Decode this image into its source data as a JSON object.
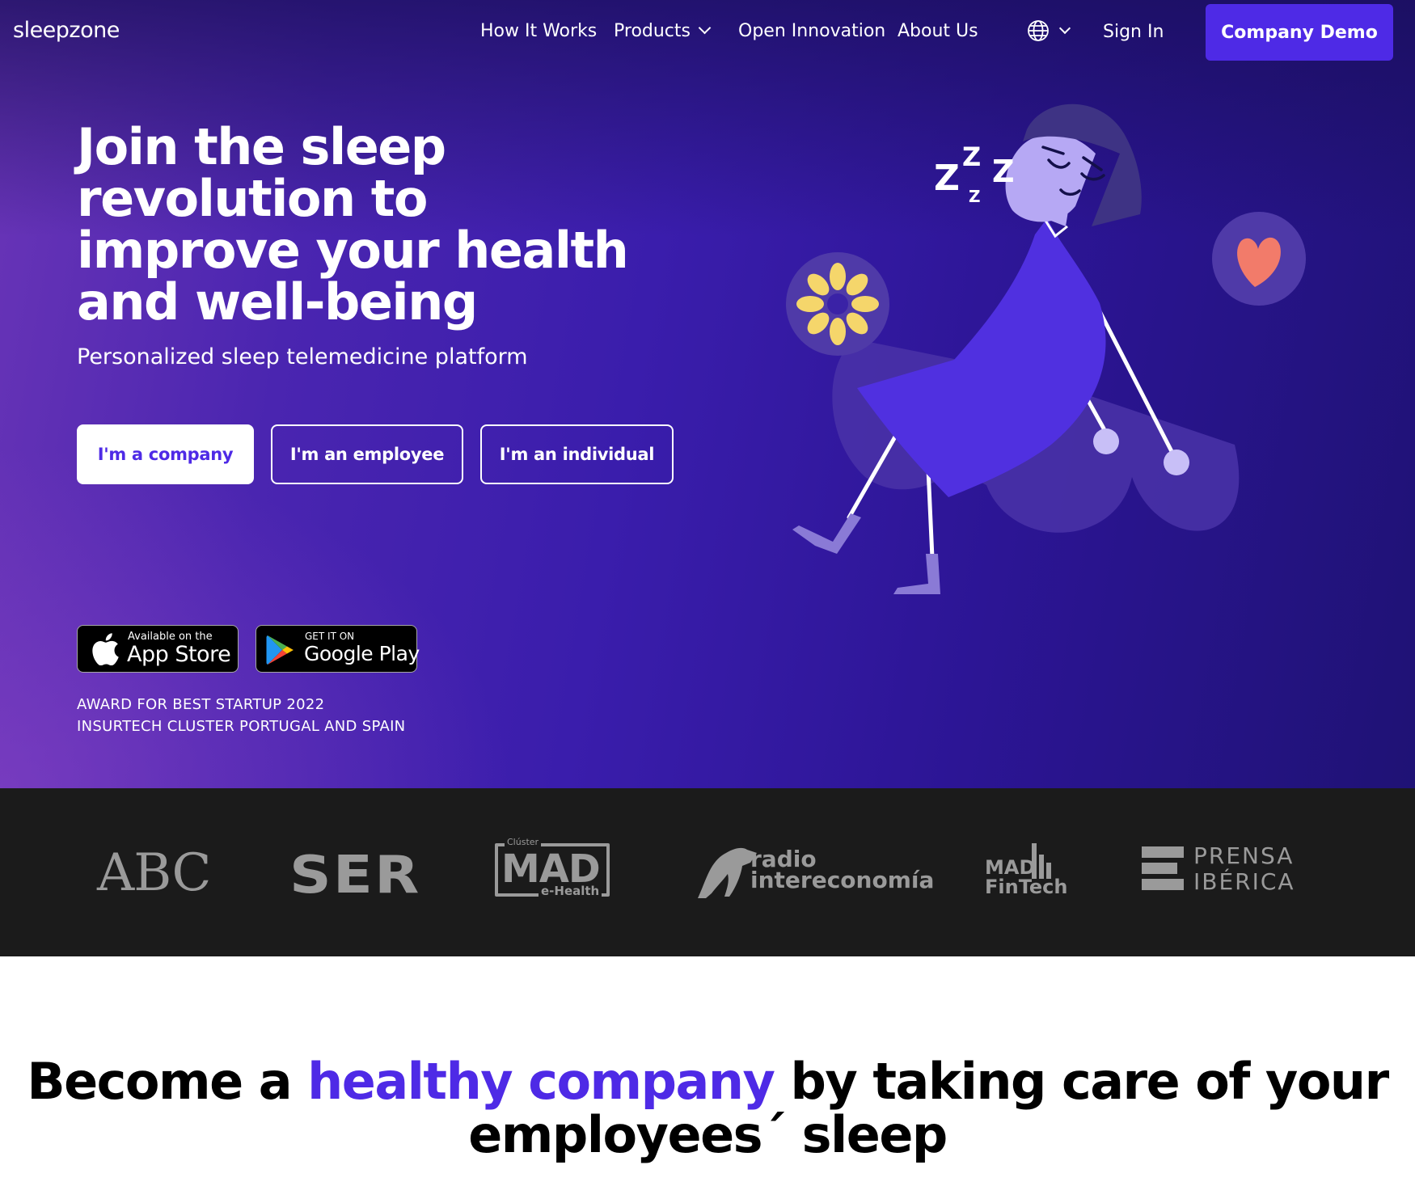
{
  "nav": {
    "logo": "sleepzone",
    "links": [
      "How It Works",
      "Products",
      "Open Innovation",
      "About Us"
    ],
    "language_icon": "globe-icon",
    "sign_in": "Sign In",
    "demo_button": "Company Demo"
  },
  "hero": {
    "headline": "Join the sleep revolution to improve your health and well-being",
    "subheadline": "Personalized sleep telemedicine platform",
    "buttons": [
      "I'm a company",
      "I'm an employee",
      "I'm an individual"
    ],
    "app_store": {
      "small": "Available on the",
      "big": "App Store"
    },
    "google_play": {
      "small": "GET IT ON",
      "big": "Google Play"
    },
    "award_line1": "AWARD FOR BEST STARTUP 2022",
    "award_line2": "INSURTECH CLUSTER PORTUGAL AND SPAIN",
    "illustration_text": {
      "z1": "Z",
      "z2": "Z",
      "z3": "Z",
      "z4": "Z"
    }
  },
  "press": {
    "abc": "ABC",
    "ser": "SER",
    "mad_top": "Clúster",
    "mad": "MAD",
    "mad_bottom": "e-Health",
    "radio_top": "radio",
    "radio_bottom": "intereconomía",
    "fintech_top": "MAD",
    "fintech_bottom": "FinTech",
    "prensa_top": "PRENSA",
    "prensa_bottom": "IBÉRICA"
  },
  "section": {
    "title_pre": "Become a ",
    "title_accent": "healthy company",
    "title_post": " by taking care of your employees´ sleep"
  },
  "colors": {
    "accent": "#4e2ae6",
    "hero_dark": "#1f1275",
    "hero_light": "#6a35b7",
    "press_bg": "#1b1b1b"
  }
}
